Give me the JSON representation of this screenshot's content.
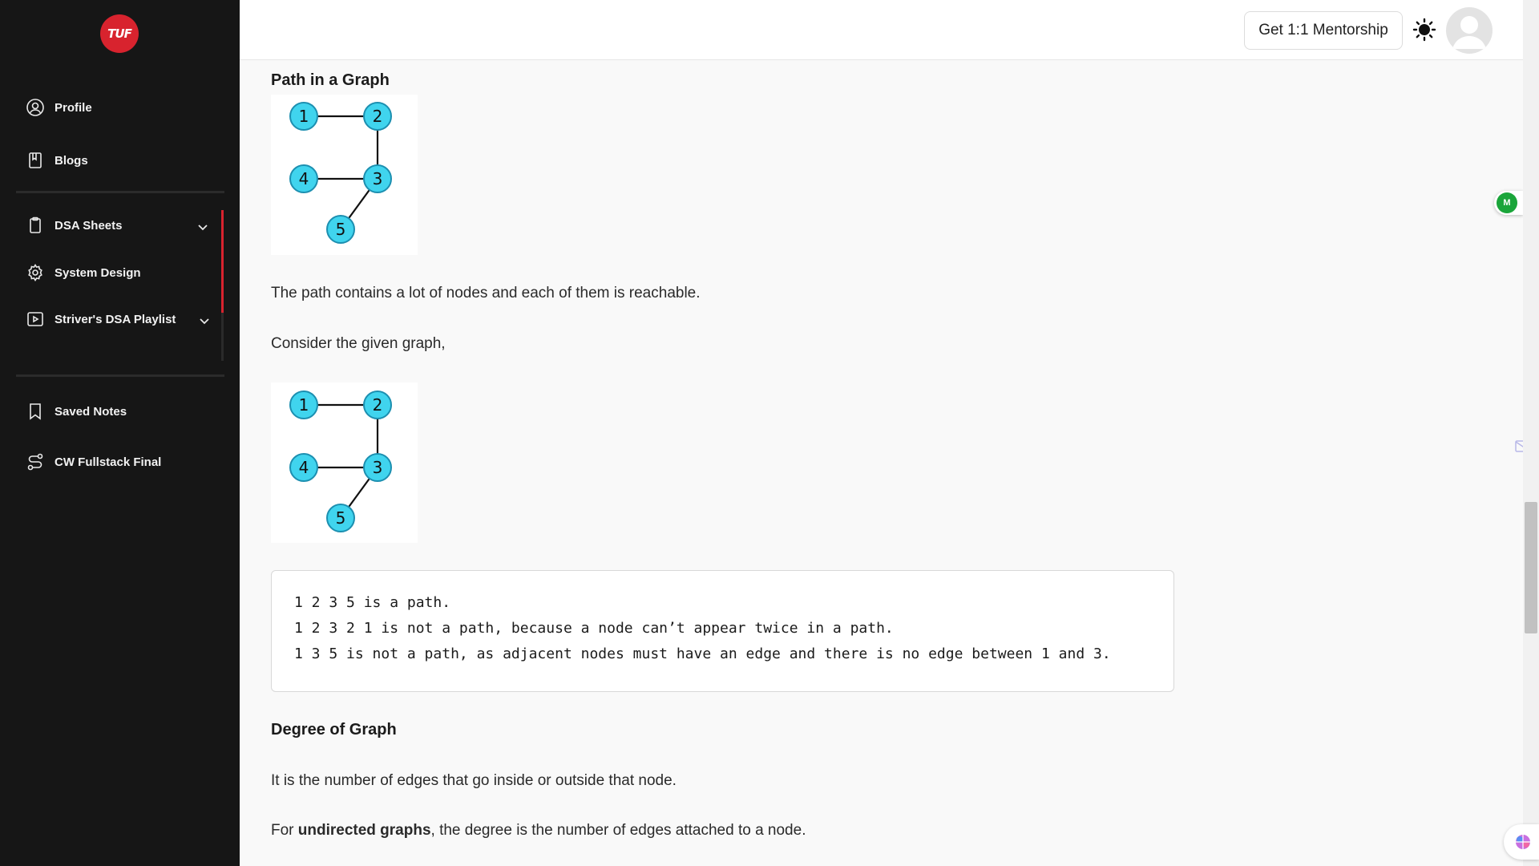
{
  "sidebar": {
    "logo_text": "TUF",
    "items_top": [
      {
        "label": "Profile",
        "icon": "user-circle-icon"
      },
      {
        "label": "Blogs",
        "icon": "book-icon"
      }
    ],
    "items_mid": [
      {
        "label": "DSA Sheets",
        "icon": "clipboard-icon"
      },
      {
        "label": "System Design",
        "icon": "gear-icon"
      },
      {
        "label": "Striver's DSA Playlist",
        "icon": "video-icon"
      }
    ],
    "items_bottom": [
      {
        "label": "Saved Notes",
        "icon": "bookmark-icon"
      },
      {
        "label": "CW Fullstack Final",
        "icon": "route-icon"
      }
    ]
  },
  "header": {
    "mentorship_label": "Get 1:1 Mentorship",
    "theme_icon": "sun-icon",
    "avatar_icon": "avatar-icon"
  },
  "article": {
    "section1_title": "Path in a Graph",
    "graph_nodes": [
      "1",
      "2",
      "3",
      "4",
      "5"
    ],
    "para1": "The path contains a lot of nodes and each of them is reachable.",
    "para2": "Consider the given graph,",
    "code_lines": [
      "1 2 3 5 is a path.",
      "1 2 3 2 1 is not a path, because a node can’t appear twice in a path.",
      "1 3 5 is not a path, as adjacent nodes must have an edge and there is no edge between 1 and 3."
    ],
    "section2_title": "Degree of Graph",
    "para3": "It is the number of edges that go inside or outside that node.",
    "para4_prefix": "For ",
    "para4_bold": "undirected graphs",
    "para4_suffix": ", the degree is the number of edges attached to a node."
  },
  "floating": {
    "badge_text": "M"
  },
  "colors": {
    "sidebar_bg": "#161616",
    "brand_red": "#d8232e",
    "node_fill": "#40d4ee",
    "page_bg": "#f9f9f9"
  }
}
